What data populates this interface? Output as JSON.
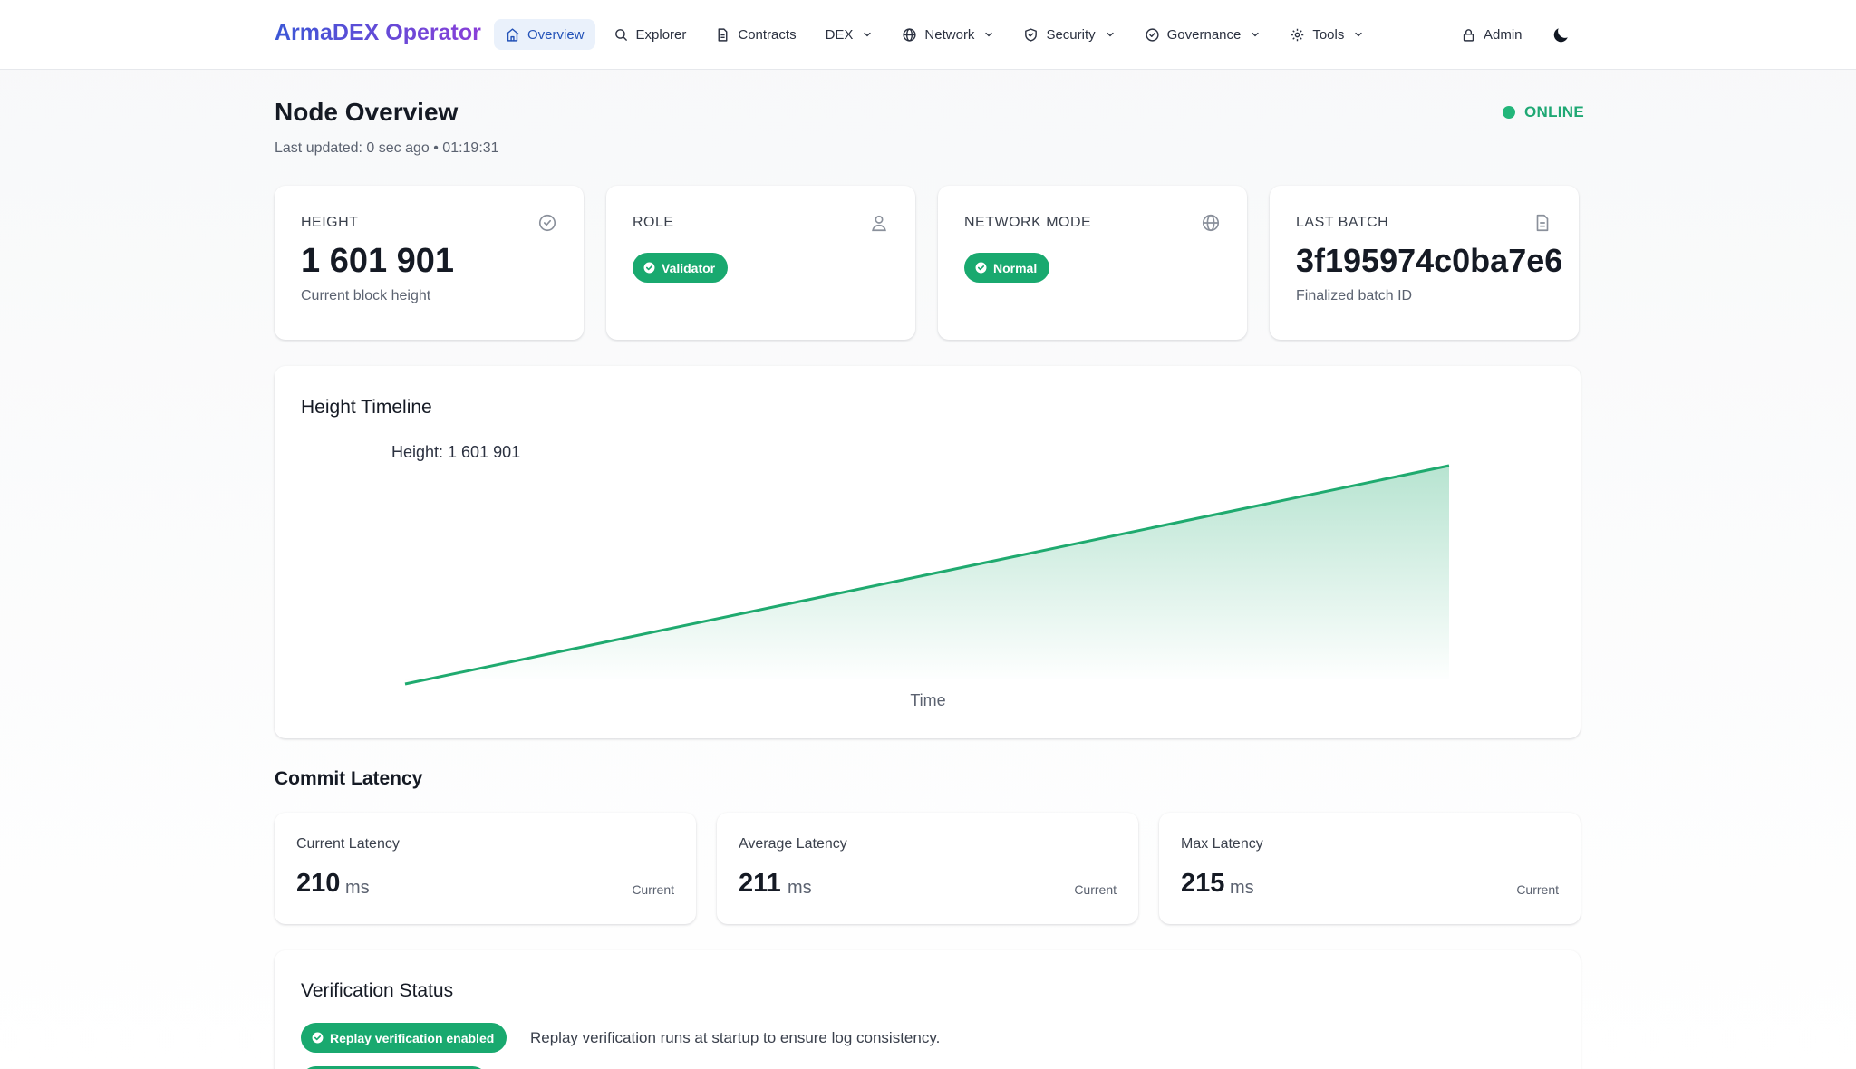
{
  "app": {
    "brand": "ArmaDEX Operator"
  },
  "nav": {
    "items": [
      {
        "label": "Overview",
        "icon": "home-icon",
        "active": true,
        "dropdown": false
      },
      {
        "label": "Explorer",
        "icon": "search-icon",
        "active": false,
        "dropdown": false
      },
      {
        "label": "Contracts",
        "icon": "document-icon",
        "active": false,
        "dropdown": false
      },
      {
        "label": "DEX",
        "icon": "",
        "active": false,
        "dropdown": true
      },
      {
        "label": "Network",
        "icon": "globe-icon",
        "active": false,
        "dropdown": true
      },
      {
        "label": "Security",
        "icon": "shield-icon",
        "active": false,
        "dropdown": true
      },
      {
        "label": "Governance",
        "icon": "check-circle-icon",
        "active": false,
        "dropdown": true
      },
      {
        "label": "Tools",
        "icon": "gear-icon",
        "active": false,
        "dropdown": true
      }
    ],
    "admin_label": "Admin",
    "admin_icon": "lock-icon",
    "theme_icon": "moon-icon"
  },
  "page": {
    "title": "Node Overview",
    "last_updated": "Last updated: 0 sec ago • 01:19:31",
    "status": "ONLINE",
    "status_color": "#22b67a"
  },
  "stats": {
    "height": {
      "label": "HEIGHT",
      "value": "1 601 901",
      "desc": "Current block height",
      "icon": "check-circle-icon"
    },
    "role": {
      "label": "ROLE",
      "badge": "Validator",
      "icon": "user-icon"
    },
    "network_mode": {
      "label": "NETWORK MODE",
      "badge": "Normal",
      "icon": "globe-icon"
    },
    "last_batch": {
      "label": "LAST BATCH",
      "value": "3f195974c0ba7e6",
      "desc": "Finalized batch ID",
      "icon": "document-icon"
    }
  },
  "chart": {
    "title": "Height Timeline",
    "tooltip": "Height: 1 601 901",
    "xlabel": "Time"
  },
  "chart_data": {
    "type": "area",
    "title": "Height Timeline",
    "xlabel": "Time",
    "ylabel": "",
    "x": [
      0,
      1
    ],
    "series": [
      {
        "values": [
          1601000,
          1601901
        ]
      }
    ],
    "ylim": [
      1601000,
      1601901
    ],
    "grid": false,
    "legend": "none",
    "line_color": "#1faa6f"
  },
  "latency": {
    "title": "Commit Latency",
    "cards": [
      {
        "label": "Current Latency",
        "value": "210",
        "unit": "ms",
        "tag": "Current"
      },
      {
        "label": "Average Latency",
        "value": "211",
        "unit": "ms",
        "tag": "Current"
      },
      {
        "label": "Max Latency",
        "value": "215",
        "unit": "ms",
        "tag": "Current"
      }
    ]
  },
  "verification": {
    "title": "Verification Status",
    "badge": "Replay verification enabled",
    "desc": "Replay verification runs at startup to ensure log consistency."
  },
  "colors": {
    "accent": "#2453b8",
    "success": "#19a96f",
    "brand_gradient_start": "#3b57d6",
    "brand_gradient_end": "#8a3fd8"
  }
}
